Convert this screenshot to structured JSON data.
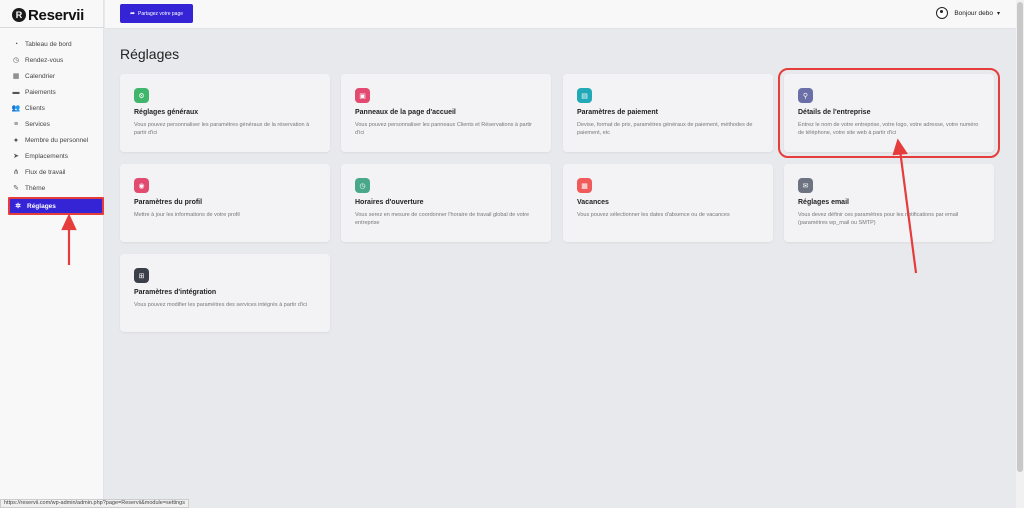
{
  "brand": {
    "name": "Reservii",
    "mark": "R"
  },
  "sidebar": {
    "items": [
      {
        "label": "Tableau de bord",
        "icon": "gauge-icon",
        "glyph": "◔"
      },
      {
        "label": "Rendez-vous",
        "icon": "calendar-check-icon",
        "glyph": "◷"
      },
      {
        "label": "Calendrier",
        "icon": "calendar-icon",
        "glyph": "▦"
      },
      {
        "label": "Paiements",
        "icon": "wallet-icon",
        "glyph": "▬"
      },
      {
        "label": "Clients",
        "icon": "users-icon",
        "glyph": "👥"
      },
      {
        "label": "Services",
        "icon": "list-icon",
        "glyph": "≡"
      },
      {
        "label": "Membre du personnel",
        "icon": "user-icon",
        "glyph": "●"
      },
      {
        "label": "Emplacements",
        "icon": "location-arrow-icon",
        "glyph": "➤"
      },
      {
        "label": "Flux de travail",
        "icon": "workflow-icon",
        "glyph": "⋔"
      },
      {
        "label": "Thème",
        "icon": "brush-icon",
        "glyph": "✎"
      },
      {
        "label": "Réglages",
        "icon": "gear-icon",
        "glyph": "✲",
        "active": true
      }
    ]
  },
  "topbar": {
    "share_label": "Partagez votre page",
    "user_greeting": "Bonjour debo"
  },
  "page": {
    "title": "Réglages"
  },
  "cards": [
    {
      "title": "Réglages généraux",
      "desc": "Vous pouvez personnaliser les paramètres généraux de la réservation à partir d'ici",
      "icon": "gear-icon",
      "glyph": "⚙",
      "color": "#3fb66b"
    },
    {
      "title": "Panneaux de la page d'accueil",
      "desc": "Vous pouvez personnaliser les panneaux Clients et Réservations à partir d'ici",
      "icon": "panel-icon",
      "glyph": "▣",
      "color": "#e34a6f"
    },
    {
      "title": "Paramètres de paiement",
      "desc": "Devise, format de prix, paramètres généraux de paiement, méthodes de paiement, etc",
      "icon": "wallet-icon",
      "glyph": "▤",
      "color": "#21a9b8"
    },
    {
      "title": "Détails de l'entreprise",
      "desc": "Entrez le nom de votre entreprise, votre logo, votre adresse, votre numéro de téléphone, votre site web à partir d'ici",
      "icon": "building-icon",
      "glyph": "⚲",
      "color": "#6b6fa8"
    },
    {
      "title": "Paramètres du profil",
      "desc": "Mettre à jour les informations de votre profil",
      "icon": "user-icon",
      "glyph": "◉",
      "color": "#e34a6f"
    },
    {
      "title": "Horaires d'ouverture",
      "desc": "Vous serez en mesure de coordonner l'horaire de travail global de votre entreprise",
      "icon": "clock-icon",
      "glyph": "◷",
      "color": "#4aa88a"
    },
    {
      "title": "Vacances",
      "desc": "Vous pouvez sélectionner les dates d'absence ou de vacances",
      "icon": "calendar-icon",
      "glyph": "▦",
      "color": "#f05a5a"
    },
    {
      "title": "Réglages email",
      "desc": "Vous devez définir ces paramètres pour les notifications par email (paramètres wp_mail ou SMTP)",
      "icon": "email-icon",
      "glyph": "✉",
      "color": "#6d7380"
    },
    {
      "title": "Paramètres d'intégration",
      "desc": "Vous pouvez modifier les paramètres des services intégrés à partir d'ici",
      "icon": "integration-icon",
      "glyph": "⊞",
      "color": "#3a3f4a"
    }
  ],
  "status_url": "https://reservii.com/wp-admin/admin.php?page=Reservii&module=settings"
}
